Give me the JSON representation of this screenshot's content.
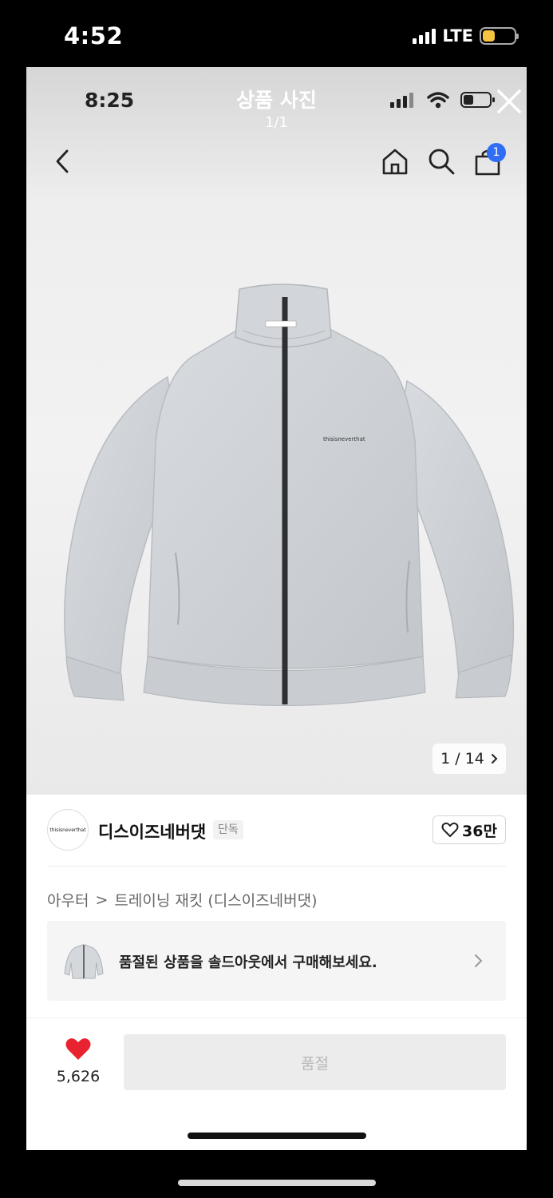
{
  "outer_status": {
    "time": "4:52",
    "network": "LTE",
    "battery_color": "#f6c443"
  },
  "inner_status": {
    "time": "8:25"
  },
  "viewer": {
    "title": "상품 사진",
    "counter": "1/1"
  },
  "header": {
    "cart_badge": "1"
  },
  "photo": {
    "page_indicator": "1 / 14",
    "jacket_logo_text": "thisisneverthat"
  },
  "brand": {
    "name": "디스이즈네버댓",
    "tag": "단독",
    "logo_text": "thisisneverthat",
    "likes": "36만"
  },
  "breadcrumb": {
    "category": "아우터",
    "separator": ">",
    "product": "트레이닝 재킷 (디스이즈네버댓)"
  },
  "banner": {
    "text": "품절된 상품을 솔드아웃에서 구매해보세요."
  },
  "bottom_bar": {
    "like_count": "5,626",
    "buy_button": "품절",
    "heart_color": "#e8232f"
  },
  "colors": {
    "accent": "#2f6df6",
    "jacket": "#cfd2d6"
  }
}
